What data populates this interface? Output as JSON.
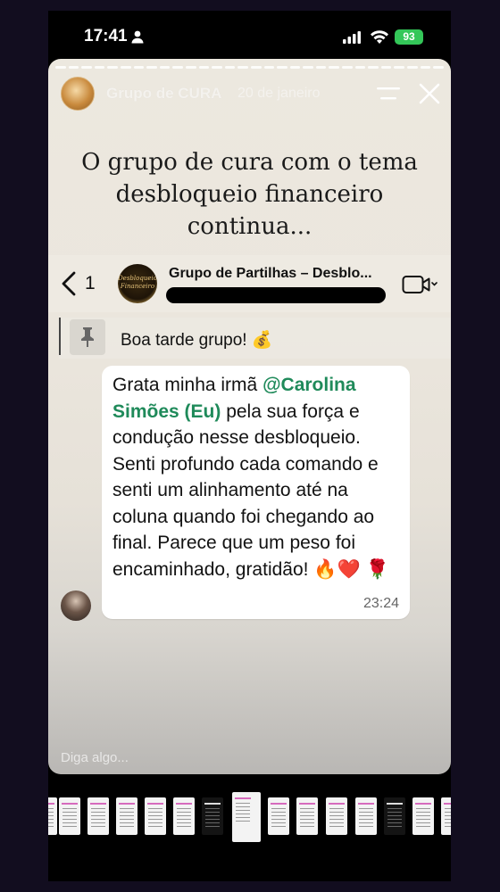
{
  "status_bar": {
    "time": "17:41",
    "battery": "93"
  },
  "story": {
    "group_name": "Grupo de CURA",
    "date": "20 de janeiro",
    "caption": "O grupo de cura com o tema desbloqueio financeiro continua...",
    "reply_placeholder": "Diga algo..."
  },
  "chat": {
    "back_count": "1",
    "avatar_text": "Desbloqueio Financeiro",
    "title": "Grupo de Partilhas – Desblo...",
    "pinned_message": "Boa tarde grupo! 💰",
    "message": {
      "text_before": "Grata minha irmã ",
      "mention": "@Carolina Simões (Eu)",
      "text_after": " pela sua força e condução nesse desbloqueio. Senti profundo cada comando e senti um alinhamento até na coluna quando foi chegando ao final. Parece que um peso foi encaminhado, gratidão! 🔥❤️ 🌹",
      "time": "23:24"
    }
  },
  "colors": {
    "mention": "#1f8a5a",
    "battery": "#34c759",
    "background": "#120d1f"
  },
  "icons": [
    "person-icon",
    "signal-icon",
    "wifi-icon",
    "menu-icon",
    "close-icon",
    "back-icon",
    "video-icon",
    "pin-icon"
  ]
}
